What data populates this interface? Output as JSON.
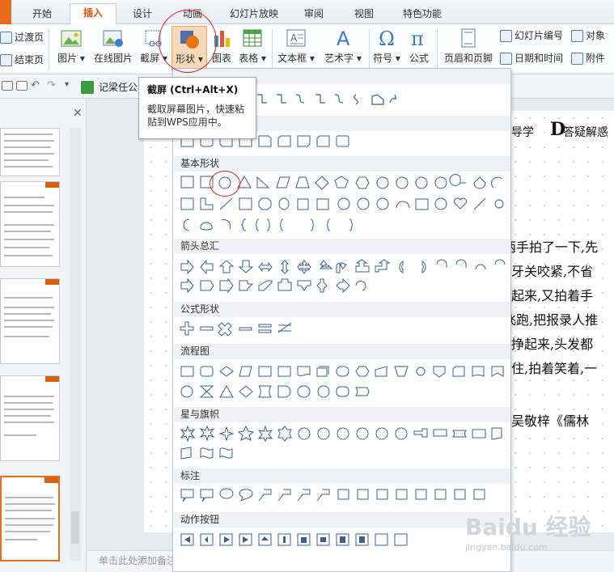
{
  "tabs": [
    {
      "label": "开始",
      "active": false
    },
    {
      "label": "插入",
      "active": true
    },
    {
      "label": "设计",
      "active": false
    },
    {
      "label": "动画",
      "active": false
    },
    {
      "label": "幻灯片放映",
      "active": false
    },
    {
      "label": "审阅",
      "active": false
    },
    {
      "label": "视图",
      "active": false
    },
    {
      "label": "特色功能",
      "active": false
    }
  ],
  "ribbon": {
    "left_small": [
      "过渡页",
      "结束页"
    ],
    "buttons": [
      {
        "label": "图片 ▾",
        "icon": "picture-icon"
      },
      {
        "label": "在线图片",
        "icon": "online-picture-icon"
      },
      {
        "label": "截屏 ▾",
        "icon": "screenshot-icon"
      },
      {
        "label": "形状 ▾",
        "icon": "shapes-icon"
      },
      {
        "label": "图表",
        "icon": "chart-icon"
      },
      {
        "label": "表格 ▾",
        "icon": "table-icon"
      },
      {
        "label": "文本框 ▾",
        "icon": "textbox-icon"
      },
      {
        "label": "艺术字 ▾",
        "icon": "wordart-icon"
      },
      {
        "label": "符号 ▾",
        "icon": "symbol-icon"
      },
      {
        "label": "公式",
        "icon": "formula-icon"
      },
      {
        "label": "页眉和页脚",
        "icon": "header-footer-icon"
      }
    ],
    "right_small": [
      "幻灯片编号",
      "对象",
      "日期和时间",
      "附件"
    ]
  },
  "document_tab": "记梁任公",
  "tooltip": {
    "title": "截屏 (Ctrl+Alt+X)",
    "body": "截取屏幕图片，快速粘贴到WPS应用中。"
  },
  "dropdown": {
    "sections": [
      "基本形状",
      "箭头总汇",
      "公式形状",
      "流程图",
      "星与旗帜",
      "标注",
      "动作按钮"
    ]
  },
  "slide": {
    "heading_frag": "和导学",
    "heading_d": "D",
    "heading_right": "答疑解惑",
    "lines": [
      "两手拍了一下,先",
      "牙关咬紧,不省",
      "起来,又拍着手",
      "飞跑,把报录人推",
      "挣起来,头发都",
      "住,拍着笑着,一",
      "吴敬梓《儒林"
    ]
  },
  "notes_placeholder": "单击此处添加备注",
  "watermark": "Baidu 经验",
  "watermark_sub": "jingyan.baidu.com",
  "colors": {
    "accent": "#d9530b",
    "highlight": "#e0211b"
  }
}
